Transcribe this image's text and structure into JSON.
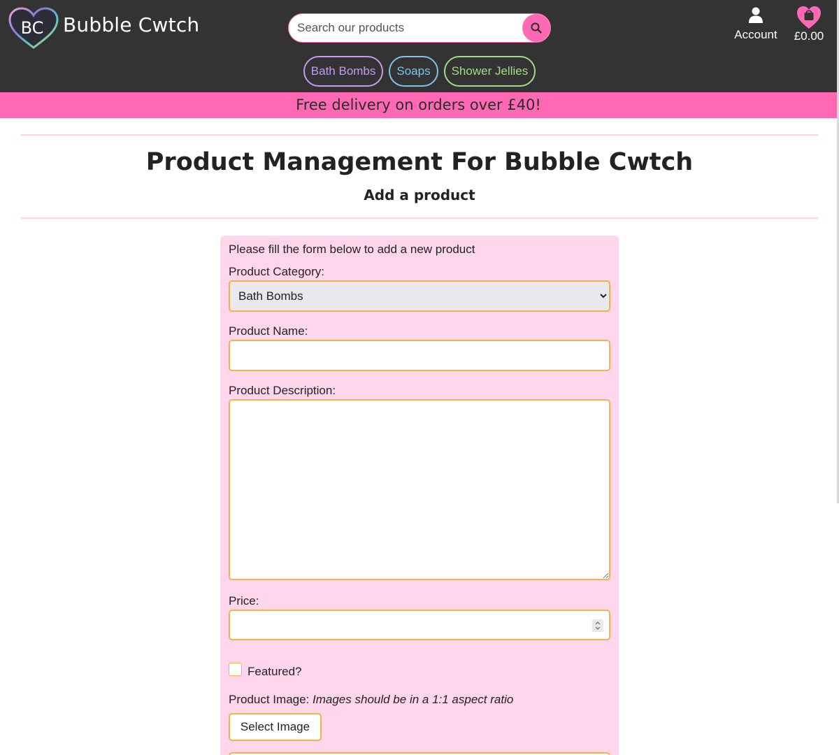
{
  "header": {
    "logo_text": "BC",
    "brand_name": "Bubble Cwtch",
    "search_placeholder": "Search our products",
    "account_label": "Account",
    "basket_total": "£0.00"
  },
  "nav": {
    "items": [
      {
        "label": "Bath Bombs",
        "color": "#c39bef"
      },
      {
        "label": "Soaps",
        "color": "#7ec4e8"
      },
      {
        "label": "Shower Jellies",
        "color": "#a7d98a"
      }
    ]
  },
  "promo": {
    "text": "Free delivery on orders over £40!"
  },
  "page": {
    "title": "Product Management For Bubble Cwtch",
    "subtitle": "Add a product"
  },
  "form": {
    "intro": "Please fill the form below to add a new product",
    "category_label": "Product Category:",
    "category_value": "Bath Bombs",
    "name_label": "Product Name:",
    "name_value": "",
    "description_label": "Product Description:",
    "description_value": "",
    "price_label": "Price:",
    "price_value": "",
    "featured_label": "Featured?",
    "image_label": "Product Image:",
    "image_hint": "Images should be in a 1:1 aspect ratio",
    "select_image_label": "Select Image"
  },
  "colors": {
    "header_bg": "#333333",
    "accent_pink": "#ff69b4",
    "form_bg": "#ffd6eb",
    "field_border": "#f6b24a"
  }
}
